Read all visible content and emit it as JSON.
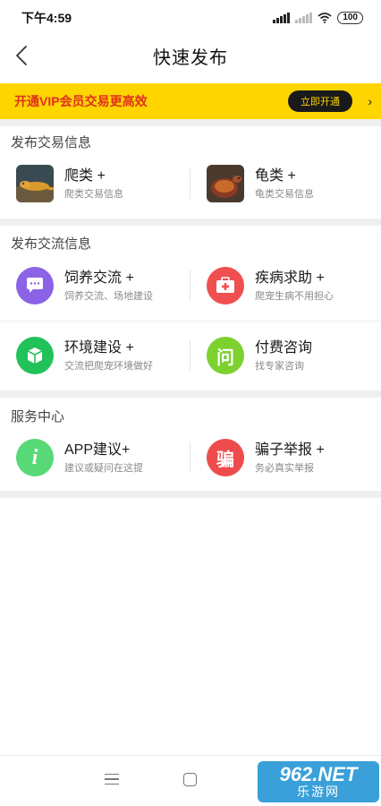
{
  "status_bar": {
    "time": "下午4:59",
    "battery": "100"
  },
  "header": {
    "title": "快速发布"
  },
  "vip_banner": {
    "text": "开通VIP会员交易更高效",
    "button": "立即开通",
    "arrow": "›"
  },
  "sections": {
    "trade": {
      "title": "发布交易信息",
      "items": [
        {
          "title": "爬类 +",
          "subtitle": "爬类交易信息"
        },
        {
          "title": "龟类 +",
          "subtitle": "龟类交易信息"
        }
      ]
    },
    "exchange": {
      "title": "发布交流信息",
      "items": [
        {
          "title": "饲养交流 +",
          "subtitle": "饲养交流、场地建设"
        },
        {
          "title": "疾病求助 +",
          "subtitle": "爬宠生病不用担心"
        },
        {
          "title": "环境建设 +",
          "subtitle": "交流把爬宠环境做好"
        },
        {
          "title": "付费咨询",
          "subtitle": "找专家咨询",
          "icon_glyph": "问"
        }
      ]
    },
    "service": {
      "title": "服务中心",
      "items": [
        {
          "title": "APP建议+",
          "subtitle": "建议或疑问在这提",
          "icon_glyph": "i"
        },
        {
          "title": "骗子举报 +",
          "subtitle": "务必真实举报",
          "icon_glyph": "骗"
        }
      ]
    }
  },
  "watermark": {
    "top": "962.NET",
    "bottom": "乐游网"
  },
  "icons": {
    "chat": "chat-bubble-icon",
    "medical": "medical-kit-icon",
    "environment": "cube-icon",
    "consult": "question-icon",
    "suggest": "info-icon",
    "report": "fraud-report-icon"
  },
  "colors": {
    "vip_background": "#ffd500",
    "vip_text": "#e0301e",
    "chat_icon": "#8b63e6",
    "medical_icon": "#ef4f4f",
    "environment_icon": "#22c25a",
    "consult_icon": "#7cd12f",
    "suggest_icon": "#58d977",
    "report_icon": "#ee4c4c"
  }
}
